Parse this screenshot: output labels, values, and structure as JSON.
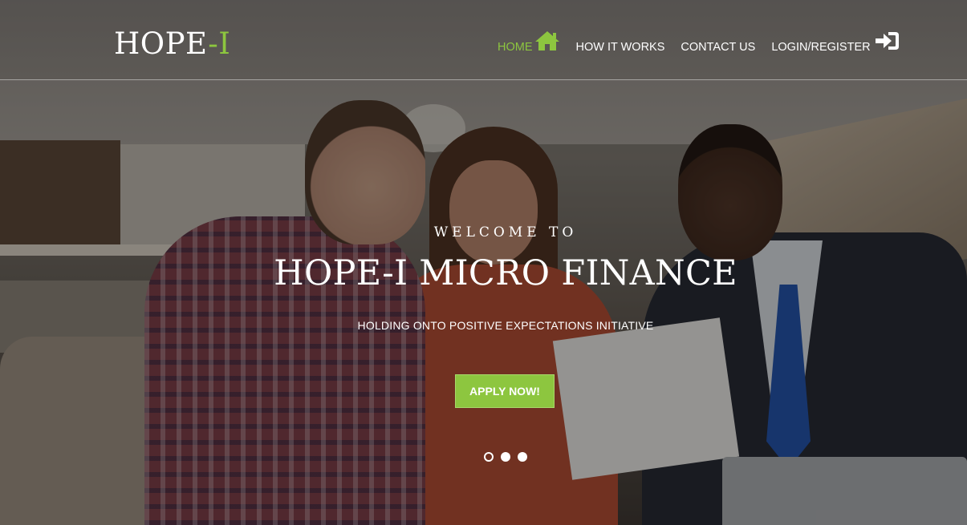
{
  "brand": {
    "name_main": "HOPE",
    "name_accent": "-I",
    "accent_color": "#8dc63f"
  },
  "nav": {
    "items": [
      {
        "label": "HOME",
        "icon": "home-icon",
        "active": true
      },
      {
        "label": "HOW IT WORKS"
      },
      {
        "label": "CONTACT US"
      },
      {
        "label": "LOGIN/REGISTER",
        "icon": "sign-in-icon"
      }
    ]
  },
  "hero": {
    "welcome": "WELCOME TO",
    "title": "HOPE-I MICRO FINANCE",
    "subtitle": "HOLDING ONTO POSITIVE EXPECTATIONS INITIATIVE",
    "cta_label": "APPLY NOW!",
    "cta_color": "#8dc63f",
    "slides_count": 3,
    "active_slide": 1,
    "background_image": "couple-with-financial-advisor-photo"
  }
}
